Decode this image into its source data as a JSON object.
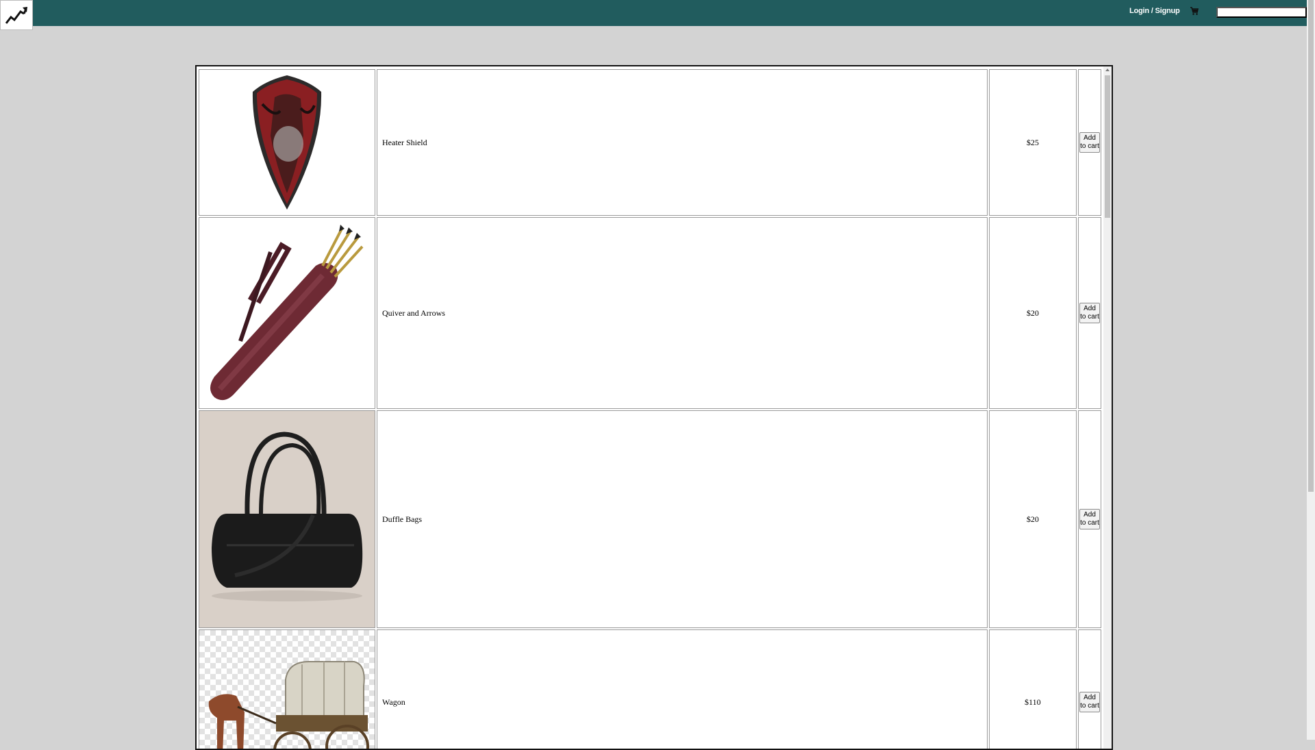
{
  "header": {
    "logo_icon": "trend-chart-icon",
    "login_label": "Login / Signup",
    "cart_icon": "shopping-cart-icon",
    "search_value": "",
    "search_placeholder": ""
  },
  "colors": {
    "header_bg": "#215c5e",
    "page_bg": "#d3d3d3"
  },
  "products": [
    {
      "image_icon": "heater-shield-image",
      "name": "Heater Shield",
      "price": "$25",
      "button_label": "Add to cart"
    },
    {
      "image_icon": "quiver-arrows-image",
      "name": "Quiver and Arrows",
      "price": "$20",
      "button_label": "Add to cart"
    },
    {
      "image_icon": "duffle-bag-image",
      "name": "Duffle Bags",
      "price": "$20",
      "button_label": "Add to cart"
    },
    {
      "image_icon": "wagon-image",
      "name": "Wagon",
      "price": "$110",
      "button_label": "Add to cart"
    }
  ]
}
